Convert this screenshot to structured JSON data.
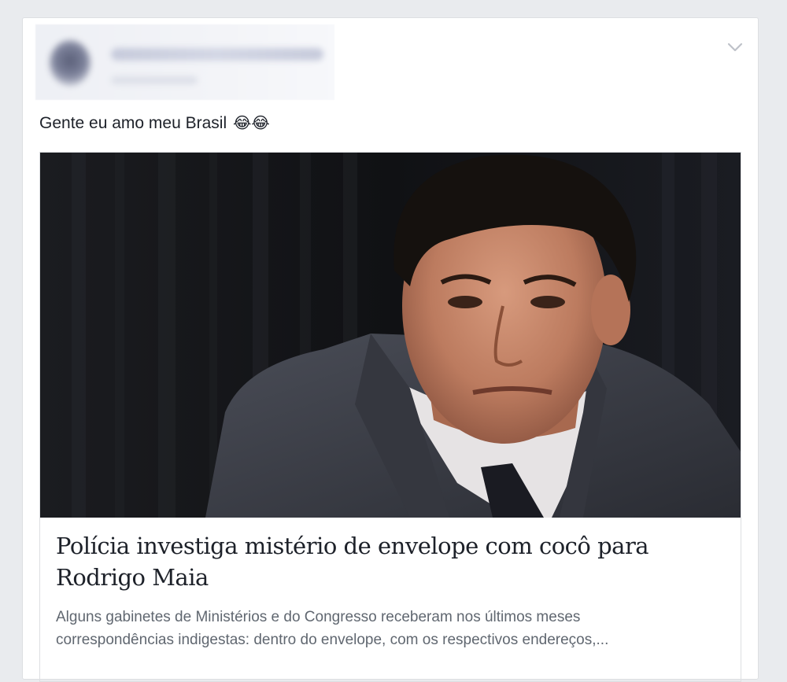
{
  "post": {
    "text": "Gente eu amo meu Brasil",
    "emoji": "😂😂",
    "options_icon": "chevron-down-icon"
  },
  "link_preview": {
    "headline": "Polícia investiga mistério de envelope com cocô para Rodrigo Maia",
    "description_line1": "Alguns gabinetes de Ministérios e do Congresso receberam nos últimos meses",
    "description_line2": "correspondências indigestas: dentro do envelope, com os respectivos endereços,..."
  },
  "colors": {
    "page_background": "#e9ebee",
    "card_background": "#ffffff",
    "card_border": "#dddfe2",
    "primary_text": "#1d2129",
    "secondary_text": "#606770"
  }
}
